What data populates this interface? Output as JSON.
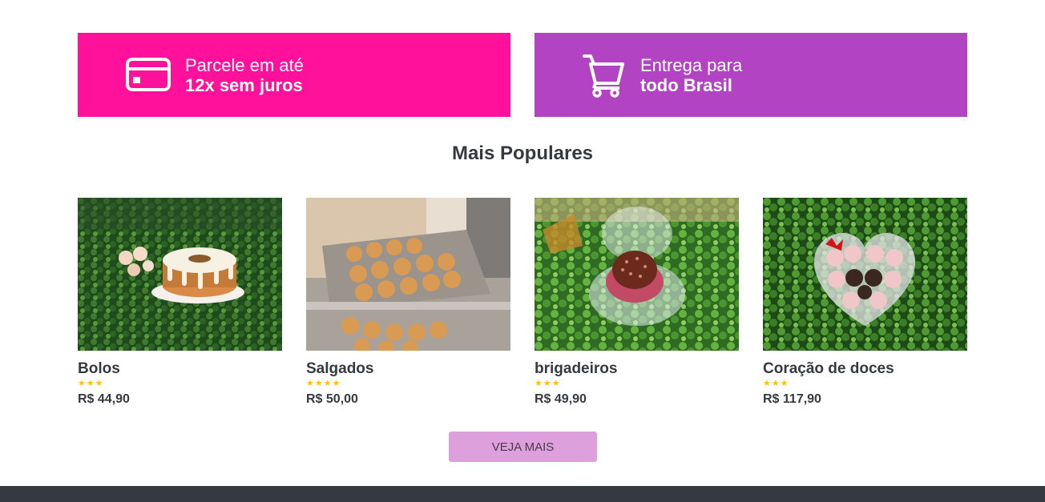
{
  "banners": [
    {
      "line1": "Parcele em até",
      "line2": "12x sem juros",
      "icon": "credit-card-icon",
      "color": "#ff119c"
    },
    {
      "line1": "Entrega para",
      "line2": "todo Brasil",
      "icon": "shopping-cart-icon",
      "color": "#b243c2"
    }
  ],
  "section": {
    "title": "Mais Populares"
  },
  "products": [
    {
      "name": "Bolos",
      "stars": "★★★",
      "price": "R$ 44,90",
      "image": "bundt-cake-photo"
    },
    {
      "name": "Salgados",
      "stars": "★★★★",
      "price": "R$ 50,00",
      "image": "fried-snacks-photo"
    },
    {
      "name": "brigadeiros",
      "stars": "★★★",
      "price": "R$ 49,90",
      "image": "brigadeiro-photo"
    },
    {
      "name": "Coração de doces",
      "stars": "★★★",
      "price": "R$ 117,90",
      "image": "heart-box-sweets-photo"
    }
  ],
  "more_button": {
    "label": "VEJA MAIS"
  },
  "colors": {
    "accent_pink": "#ff119c",
    "accent_purple": "#b243c2",
    "button": "#dda0dd",
    "footer": "#343a40",
    "stars": "#ffc107"
  }
}
